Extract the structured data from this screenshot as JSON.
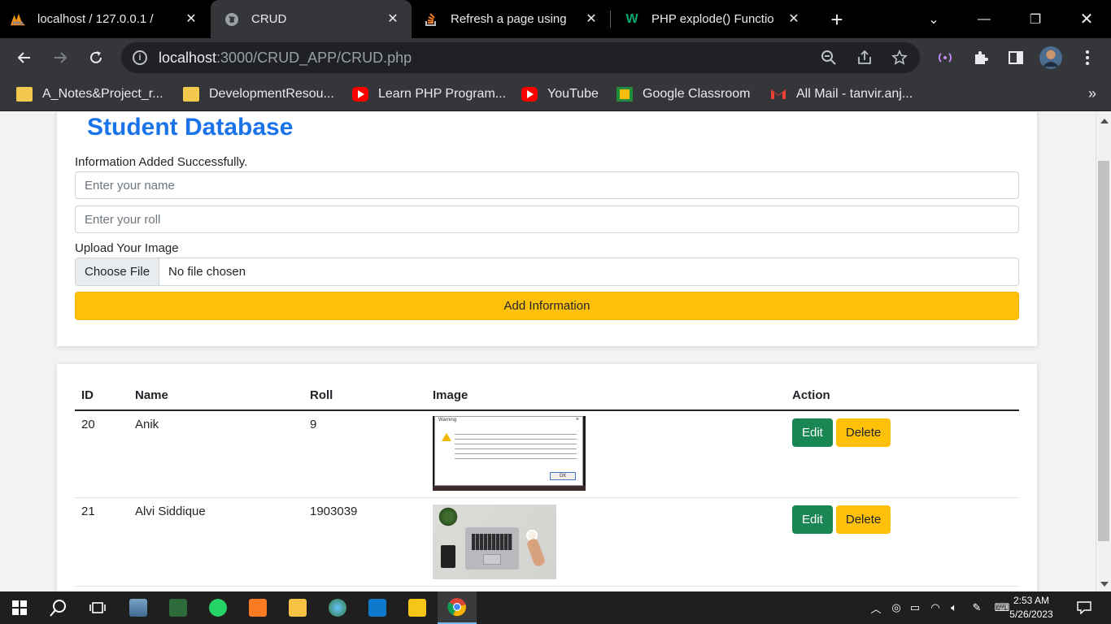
{
  "browser": {
    "tabs": [
      {
        "title": "localhost / 127.0.0.1 /",
        "icon": "phpmyadmin-icon"
      },
      {
        "title": "CRUD",
        "icon": "globe-icon",
        "active": true
      },
      {
        "title": "Refresh a page using",
        "icon": "stackoverflow-icon"
      },
      {
        "title": "PHP explode() Functio",
        "icon": "w3schools-icon"
      }
    ],
    "address": {
      "host": "localhost",
      "path": ":3000/CRUD_APP/CRUD.php"
    },
    "bookmarks": [
      {
        "label": "A_Notes&Project_r...",
        "icon": "folder-icon"
      },
      {
        "label": "DevelopmentResou...",
        "icon": "folder-icon"
      },
      {
        "label": "Learn PHP Program...",
        "icon": "youtube-icon"
      },
      {
        "label": "YouTube",
        "icon": "youtube-icon"
      },
      {
        "label": "Google Classroom",
        "icon": "google-classroom-icon"
      },
      {
        "label": "All Mail - tanvir.anj...",
        "icon": "gmail-icon"
      }
    ]
  },
  "page": {
    "title": "Student Database",
    "message": "Information Added Successfully.",
    "form": {
      "name_placeholder": "Enter your name",
      "roll_placeholder": "Enter your roll",
      "upload_label": "Upload Your Image",
      "file_button": "Choose File",
      "file_status": "No file chosen",
      "submit_label": "Add Information"
    },
    "table": {
      "headers": {
        "id": "ID",
        "name": "Name",
        "roll": "Roll",
        "image": "Image",
        "action": "Action"
      },
      "rows": [
        {
          "id": "20",
          "name": "Anik",
          "roll": "9",
          "image": "uac-warning-screenshot",
          "edit": "Edit",
          "delete": "Delete"
        },
        {
          "id": "21",
          "name": "Alvi Siddique",
          "roll": "1903039",
          "image": "laptop-desk-photo",
          "edit": "Edit",
          "delete": "Delete"
        }
      ],
      "warning_image": {
        "title": "Warning",
        "ok": "OK"
      }
    }
  },
  "taskbar": {
    "time": "2:53 AM",
    "date": "5/26/2023"
  },
  "colors": {
    "title_blue": "#1a73e8",
    "warning_yellow": "#ffc107",
    "success_green": "#198754"
  }
}
